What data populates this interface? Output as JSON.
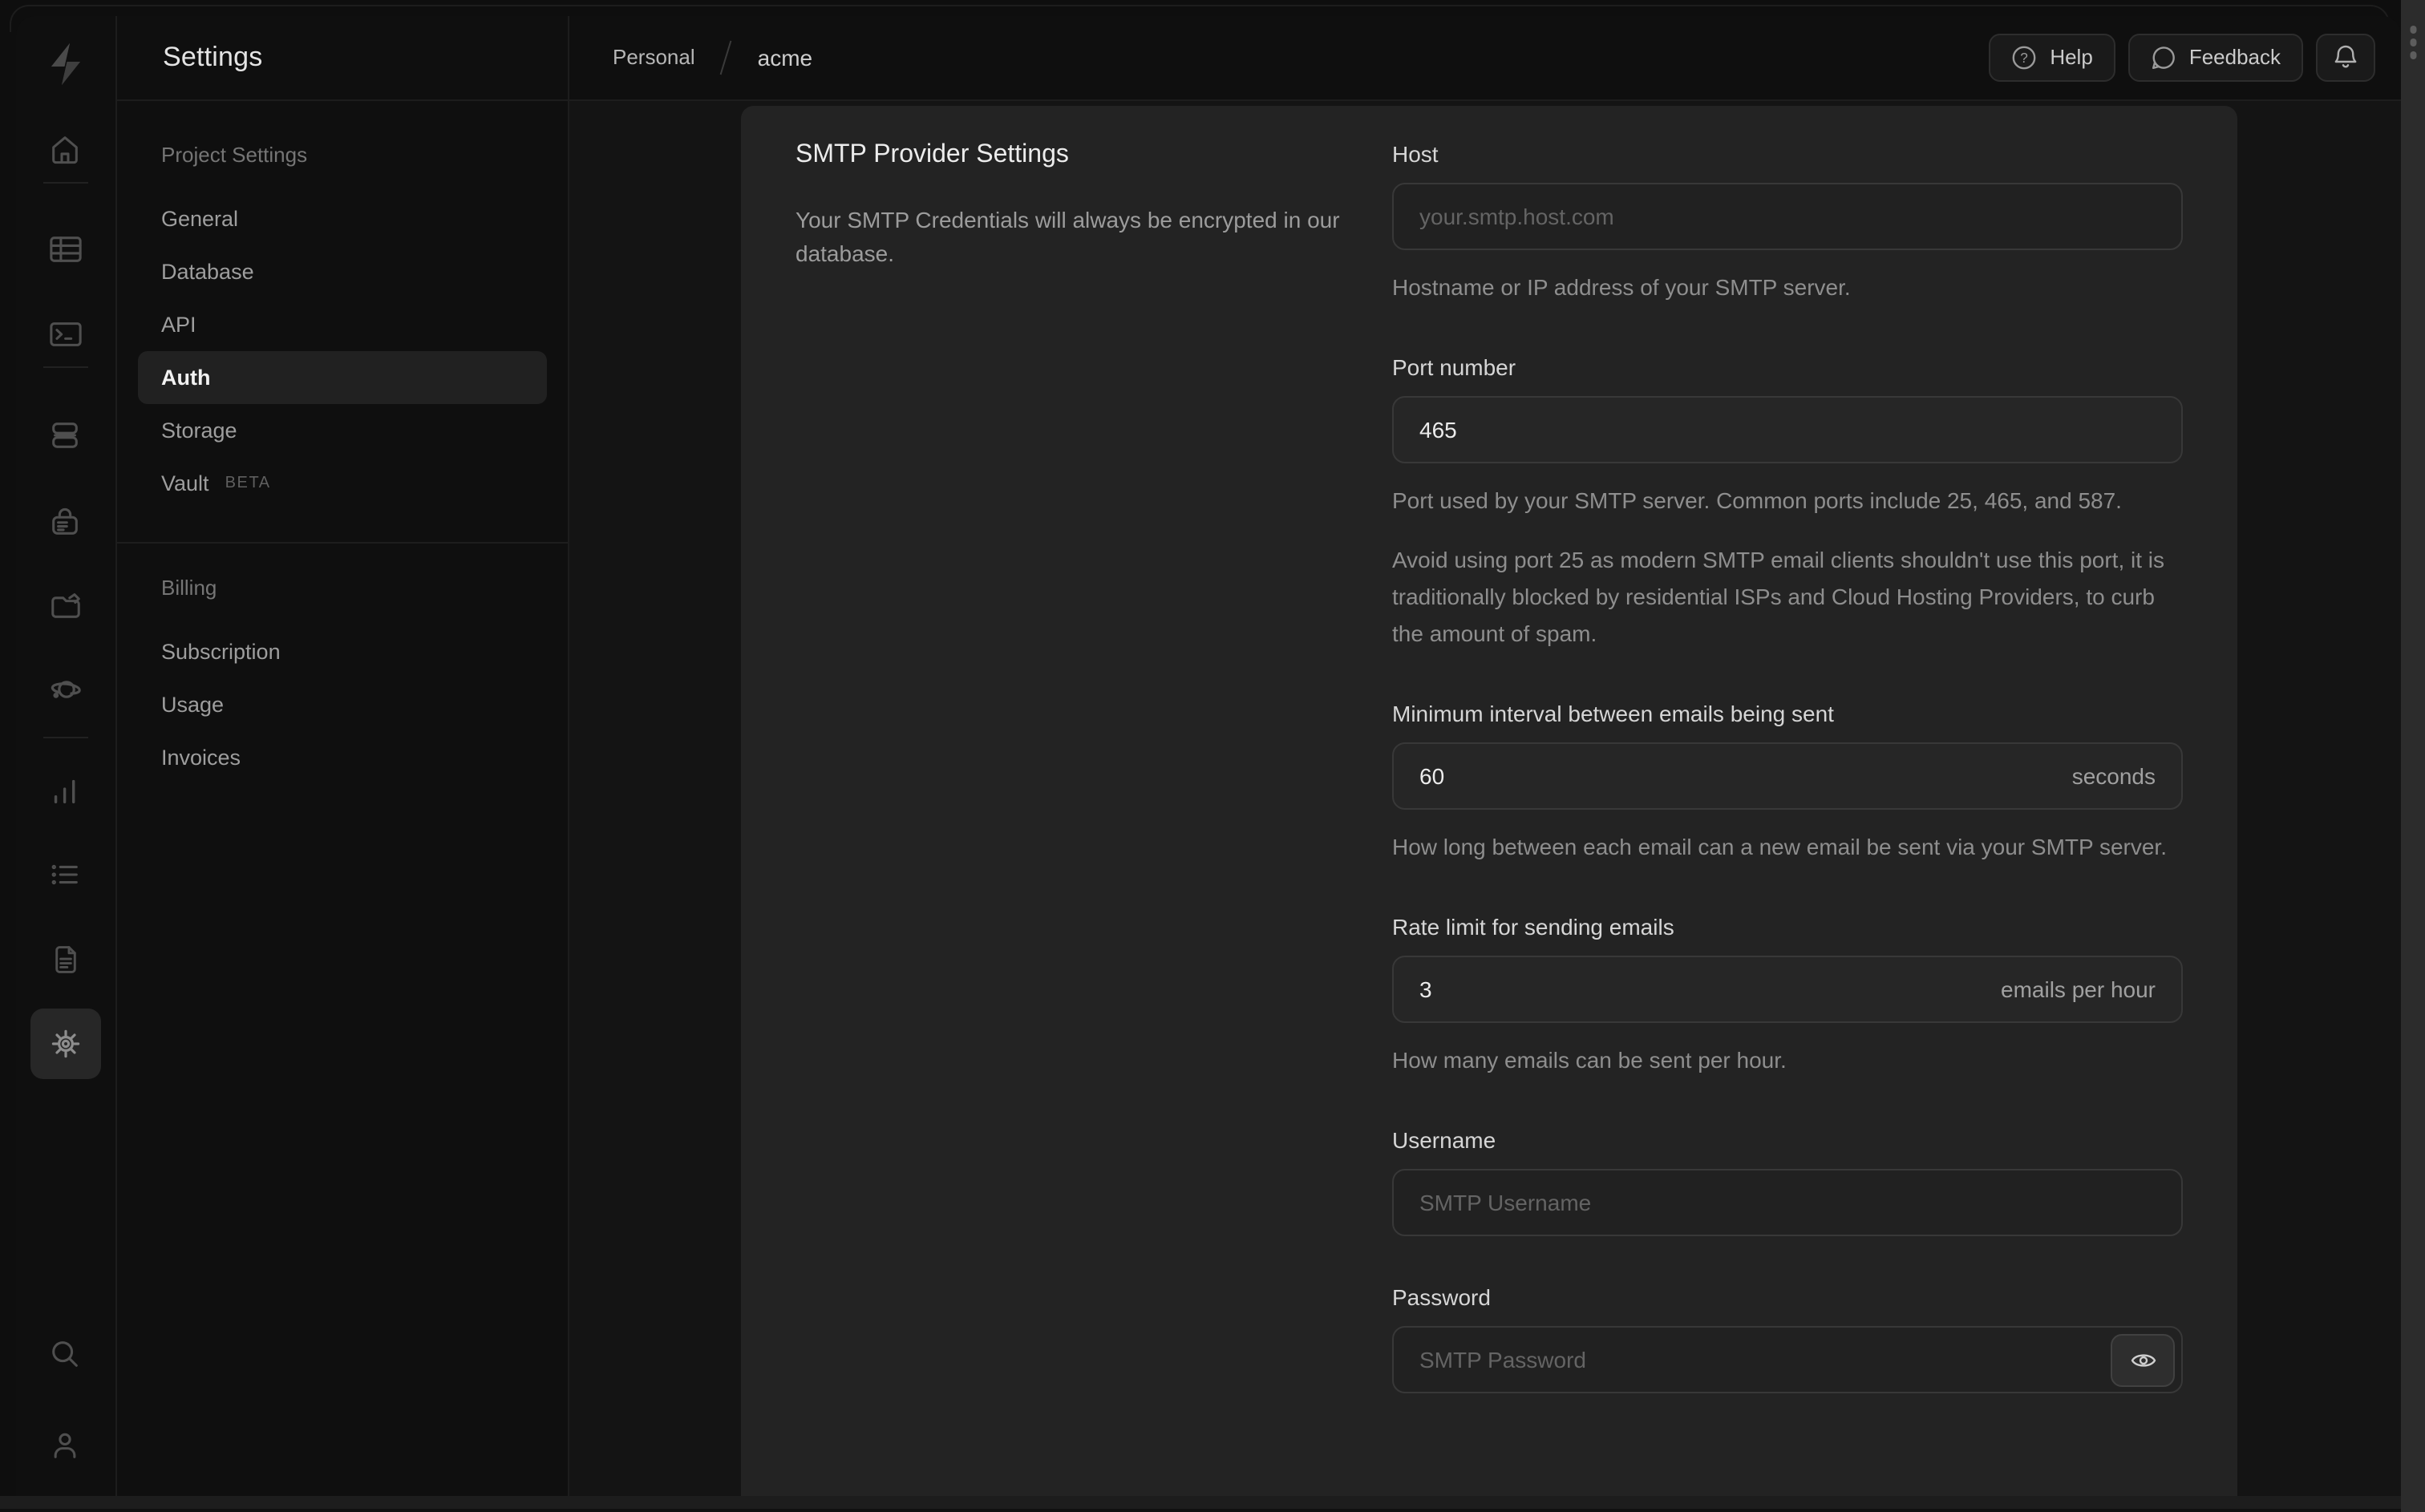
{
  "colors": {
    "chrome_bg": "#0f0f0f",
    "content_bg": "#141414",
    "card_bg": "#232323",
    "input_border": "#383838",
    "text_primary": "#ececec",
    "text_muted": "#8e8e8e"
  },
  "rail": {
    "icons": [
      "supabase-logo",
      "home",
      "table-editor",
      "sql-editor",
      "database",
      "auth",
      "storage",
      "edge-functions",
      "reports",
      "logs",
      "api-docs",
      "settings",
      "search",
      "user"
    ]
  },
  "sidebar": {
    "title": "Settings",
    "sections": [
      {
        "header": "Project Settings",
        "items": [
          {
            "label": "General"
          },
          {
            "label": "Database"
          },
          {
            "label": "API"
          },
          {
            "label": "Auth",
            "active": true
          },
          {
            "label": "Storage"
          },
          {
            "label": "Vault",
            "badge": "BETA"
          }
        ]
      },
      {
        "header": "Billing",
        "items": [
          {
            "label": "Subscription"
          },
          {
            "label": "Usage"
          },
          {
            "label": "Invoices"
          }
        ]
      }
    ]
  },
  "topbar": {
    "breadcrumb": {
      "org": "Personal",
      "project": "acme"
    },
    "help_label": "Help",
    "feedback_label": "Feedback"
  },
  "panel": {
    "title": "SMTP Provider Settings",
    "description": "Your SMTP Credentials will always be encrypted in our database.",
    "fields": {
      "host": {
        "label": "Host",
        "placeholder": "your.smtp.host.com",
        "helper": "Hostname or IP address of your SMTP server."
      },
      "port": {
        "label": "Port number",
        "value": "465",
        "helper": "Port used by your SMTP server. Common ports include 25, 465, and 587.",
        "helper2": "Avoid using port 25 as modern SMTP email clients shouldn't use this port, it is traditionally blocked by residential ISPs and Cloud Hosting Providers, to curb the amount of spam."
      },
      "interval": {
        "label": "Minimum interval between emails being sent",
        "value": "60",
        "suffix": "seconds",
        "helper": "How long between each email can a new email be sent via your SMTP server."
      },
      "rate": {
        "label": "Rate limit for sending emails",
        "value": "3",
        "suffix": "emails per hour",
        "helper": "How many emails can be sent per hour."
      },
      "username": {
        "label": "Username",
        "placeholder": "SMTP Username"
      },
      "password": {
        "label": "Password",
        "placeholder": "SMTP Password"
      }
    }
  }
}
